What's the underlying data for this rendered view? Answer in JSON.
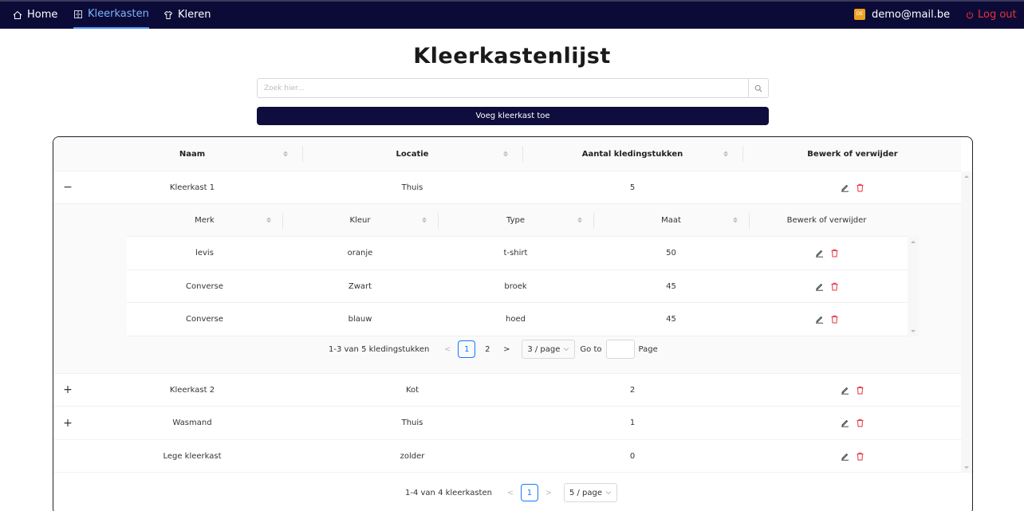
{
  "nav": {
    "home": "Home",
    "wardrobes": "Kleerkasten",
    "clothes": "Kleren",
    "user_badge": "DE",
    "user_email": "demo@mail.be",
    "logout": "Log out"
  },
  "page": {
    "title": "Kleerkastenlijst",
    "search_placeholder": "Zoek hier...",
    "add_button": "Voeg kleerkast toe"
  },
  "wardrobe_table": {
    "columns": [
      "Naam",
      "Locatie",
      "Aantal kledingstukken",
      "Bewerk of verwijder"
    ],
    "rows": [
      {
        "expander": "−",
        "name": "Kleerkast 1",
        "location": "Thuis",
        "count": "5"
      },
      {
        "expander": "+",
        "name": "Kleerkast 2",
        "location": "Kot",
        "count": "2"
      },
      {
        "expander": "+",
        "name": "Wasmand",
        "location": "Thuis",
        "count": "1"
      },
      {
        "expander": "",
        "name": "Lege kleerkast",
        "location": "zolder",
        "count": "0"
      }
    ],
    "pagination": {
      "total": "1-4 van 4 kleerkasten",
      "current_page": "1",
      "page_size": "5 / page"
    }
  },
  "clothes_table": {
    "columns": [
      "Merk",
      "Kleur",
      "Type",
      "Maat",
      "Bewerk of verwijder"
    ],
    "rows": [
      {
        "brand": "levis",
        "color": "oranje",
        "type": "t-shirt",
        "size": "50"
      },
      {
        "brand": "Converse",
        "color": "Zwart",
        "type": "broek",
        "size": "45"
      },
      {
        "brand": "Converse",
        "color": "blauw",
        "type": "hoed",
        "size": "45"
      }
    ],
    "pagination": {
      "total": "1-3 van 5 kledingstukken",
      "pages": [
        "1",
        "2"
      ],
      "current_page": "1",
      "page_size": "3 / page",
      "goto_label": "Go to",
      "page_label": "Page"
    }
  },
  "colors": {
    "nav_bg": "#0c0b38",
    "active_nav": "#7ab4ff",
    "primary_button": "#0f0d3d",
    "delete": "#e8323c",
    "page_active": "#1677ff"
  }
}
